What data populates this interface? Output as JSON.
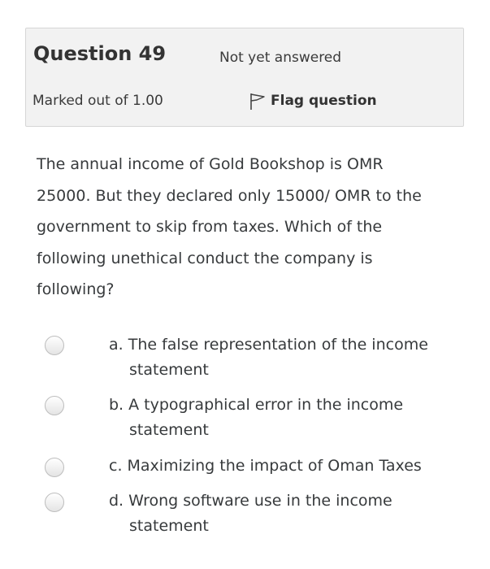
{
  "info": {
    "question_title": "Question 49",
    "state": "Not yet answered",
    "grade": "Marked out of 1.00",
    "flag_label": "Flag question"
  },
  "question": {
    "lines": [
      "The annual income of Gold Bookshop is OMR",
      "25000. But they declared only 15000/ OMR to the",
      "government to skip from taxes. Which of the",
      "following unethical conduct the company is",
      "following?"
    ]
  },
  "answers": [
    {
      "line1": "a. The false representation of the income",
      "line2": "statement"
    },
    {
      "line1": "b. A typographical error in the income",
      "line2": "statement"
    },
    {
      "line1": "c. Maximizing the impact of Oman Taxes",
      "line2": ""
    },
    {
      "line1": "d. Wrong software use in the income",
      "line2": "statement"
    }
  ],
  "colors": {
    "info_background": "#f2f2f2",
    "info_border": "#d6d6d6",
    "text": "#373a3c"
  },
  "icons": {
    "flag": "flag-outline-icon",
    "radio": "radio-unchecked-icon"
  }
}
